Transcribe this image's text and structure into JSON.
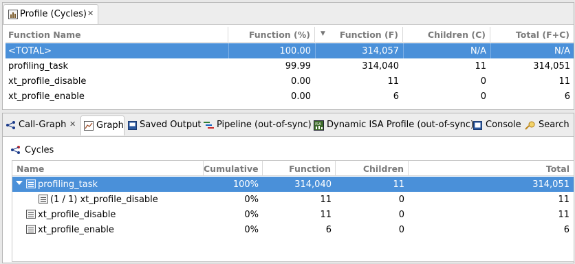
{
  "profile_view": {
    "tab_title": "Profile (Cycles)",
    "close_glyph": "✕",
    "columns": [
      "Function Name",
      "Function (%)",
      "Function (F)",
      "Children (C)",
      "Total (F+C)"
    ],
    "sort_indicator": "▼",
    "rows": [
      {
        "name": "<TOTAL>",
        "pct": "100.00",
        "func": "314,057",
        "children": "N/A",
        "total": "N/A",
        "selected": true
      },
      {
        "name": "profiling_task",
        "pct": "99.99",
        "func": "314,040",
        "children": "11",
        "total": "314,051"
      },
      {
        "name": "xt_profile_disable",
        "pct": "0.00",
        "func": "11",
        "children": "0",
        "total": "11"
      },
      {
        "name": "xt_profile_enable",
        "pct": "0.00",
        "func": "6",
        "children": "0",
        "total": "6"
      }
    ]
  },
  "bottom_tabs": [
    {
      "label": "Call-Graph",
      "icon": "call-graph-icon",
      "closable": true
    },
    {
      "label": "Graph",
      "icon": "graph-icon",
      "active": true
    },
    {
      "label": "Saved Output",
      "icon": "saved-output-icon"
    },
    {
      "label": "Pipeline (out-of-sync)",
      "icon": "pipeline-icon"
    },
    {
      "label": "Dynamic ISA Profile (out-of-sync)",
      "icon": "isa-icon"
    },
    {
      "label": "Console",
      "icon": "console-icon"
    },
    {
      "label": "Search",
      "icon": "search-icon"
    }
  ],
  "call_graph": {
    "section_title": "Cycles",
    "columns": [
      "Name",
      "Cumulative",
      "Function",
      "Children",
      "Total"
    ],
    "rows": [
      {
        "name": "profiling_task",
        "cumulative": "100%",
        "function": "314,040",
        "children": "11",
        "total": "314,051",
        "selected": true,
        "expanded": true
      },
      {
        "name": "(1 / 1) xt_profile_disable",
        "cumulative": "0%",
        "function": "11",
        "children": "0",
        "total": "11",
        "child": true
      },
      {
        "name": "xt_profile_disable",
        "cumulative": "0%",
        "function": "11",
        "children": "0",
        "total": "11"
      },
      {
        "name": "xt_profile_enable",
        "cumulative": "0%",
        "function": "6",
        "children": "0",
        "total": "6"
      }
    ]
  },
  "colors": {
    "selection": "#4a90d9",
    "header_text": "#7a7a7a"
  }
}
